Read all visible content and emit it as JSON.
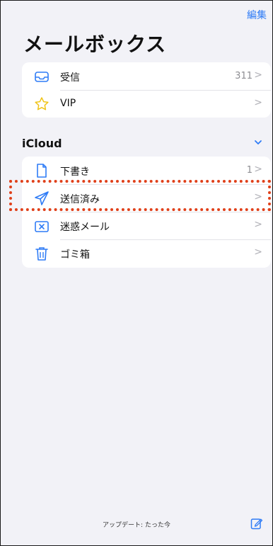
{
  "nav": {
    "edit_label": "編集"
  },
  "title": "メールボックス",
  "top_mailboxes": [
    {
      "label": "受信",
      "count": "311",
      "icon": "inbox-tray-icon"
    },
    {
      "label": "VIP",
      "count": "",
      "icon": "star-outline-icon"
    }
  ],
  "section": {
    "label": "iCloud",
    "icon": "chevron-down-icon"
  },
  "icloud_mailboxes": [
    {
      "label": "下書き",
      "count": "1",
      "icon": "document-icon"
    },
    {
      "label": "送信済み",
      "count": "",
      "icon": "paper-plane-icon"
    },
    {
      "label": "迷惑メール",
      "count": "",
      "icon": "junk-tray-icon"
    },
    {
      "label": "ゴミ箱",
      "count": "",
      "icon": "trash-icon"
    }
  ],
  "toolbar": {
    "status": "アップデート: たった今",
    "compose_icon": "compose-icon"
  },
  "colors": {
    "accent": "#2f7cf6",
    "highlight": "#e0401a",
    "background": "#f2f2f7"
  }
}
